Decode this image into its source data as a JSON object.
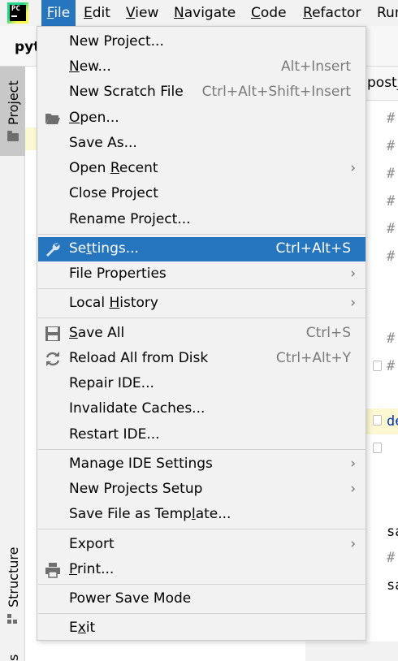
{
  "app": {
    "logo_text": "PC"
  },
  "menubar": [
    {
      "pre": "",
      "mn": "F",
      "post": "ile"
    },
    {
      "pre": "",
      "mn": "E",
      "post": "dit"
    },
    {
      "pre": "",
      "mn": "V",
      "post": "iew"
    },
    {
      "pre": "",
      "mn": "N",
      "post": "avigate"
    },
    {
      "pre": "",
      "mn": "C",
      "post": "ode"
    },
    {
      "pre": "",
      "mn": "R",
      "post": "efactor"
    },
    {
      "pre": "",
      "mn": "",
      "post": "Run"
    }
  ],
  "breadcrumb": "pyt",
  "left_strip": {
    "project_tab": "Project",
    "structure_tab": "Structure",
    "bottom_tab": "s"
  },
  "editor": {
    "tab_label": "post_",
    "lines": [
      "#",
      "#",
      "#",
      "#",
      "#",
      "#",
      "#",
      "#",
      "de",
      "sa",
      "#",
      "sa"
    ]
  },
  "file_menu": {
    "items": [
      {
        "pre": "New Project...",
        "mn": "",
        "post": "",
        "shortcut": ""
      },
      {
        "pre": "",
        "mn": "N",
        "post": "ew...",
        "shortcut": "Alt+Insert"
      },
      {
        "pre": "New Scratch File",
        "mn": "",
        "post": "",
        "shortcut": "Ctrl+Alt+Shift+Insert"
      },
      {
        "pre": "",
        "mn": "O",
        "post": "pen...",
        "shortcut": "",
        "icon": "folder-open-icon"
      },
      {
        "pre": "Save As...",
        "mn": "",
        "post": "",
        "shortcut": ""
      },
      {
        "pre": "Open ",
        "mn": "R",
        "post": "ecent",
        "shortcut": "",
        "submenu": true
      },
      {
        "pre": "Close Pro",
        "mn": "j",
        "post": "ect",
        "shortcut": ""
      },
      {
        "pre": "Rename Project...",
        "mn": "",
        "post": "",
        "shortcut": ""
      },
      {
        "pre": "Se",
        "mn": "t",
        "post": "tings...",
        "shortcut": "Ctrl+Alt+S",
        "icon": "wrench-icon",
        "selected": true
      },
      {
        "pre": "File Properties",
        "mn": "",
        "post": "",
        "shortcut": "",
        "submenu": true
      },
      {
        "pre": "Local ",
        "mn": "H",
        "post": "istory",
        "shortcut": "",
        "submenu": true
      },
      {
        "pre": "",
        "mn": "S",
        "post": "ave All",
        "shortcut": "Ctrl+S",
        "icon": "save-icon"
      },
      {
        "pre": "Reload All from Disk",
        "mn": "",
        "post": "",
        "shortcut": "Ctrl+Alt+Y",
        "icon": "reload-icon"
      },
      {
        "pre": "Repair IDE...",
        "mn": "",
        "post": "",
        "shortcut": ""
      },
      {
        "pre": "Invalidate Caches...",
        "mn": "",
        "post": "",
        "shortcut": ""
      },
      {
        "pre": "Restart IDE...",
        "mn": "",
        "post": "",
        "shortcut": ""
      },
      {
        "pre": "Manage IDE Settings",
        "mn": "",
        "post": "",
        "shortcut": "",
        "submenu": true
      },
      {
        "pre": "New Projects Setup",
        "mn": "",
        "post": "",
        "shortcut": "",
        "submenu": true
      },
      {
        "pre": "Save File as Temp",
        "mn": "l",
        "post": "ate...",
        "shortcut": ""
      },
      {
        "pre": "Export",
        "mn": "",
        "post": "",
        "shortcut": "",
        "submenu": true
      },
      {
        "pre": "",
        "mn": "P",
        "post": "rint...",
        "shortcut": "",
        "icon": "print-icon"
      },
      {
        "pre": "Power Save Mode",
        "mn": "",
        "post": "",
        "shortcut": ""
      },
      {
        "pre": "E",
        "mn": "x",
        "post": "it",
        "shortcut": ""
      }
    ]
  },
  "colors": {
    "accent": "#2675bf",
    "menu_bg": "#f2f2f2",
    "comment": "#8c8c8c",
    "keyword": "#0033b3"
  }
}
